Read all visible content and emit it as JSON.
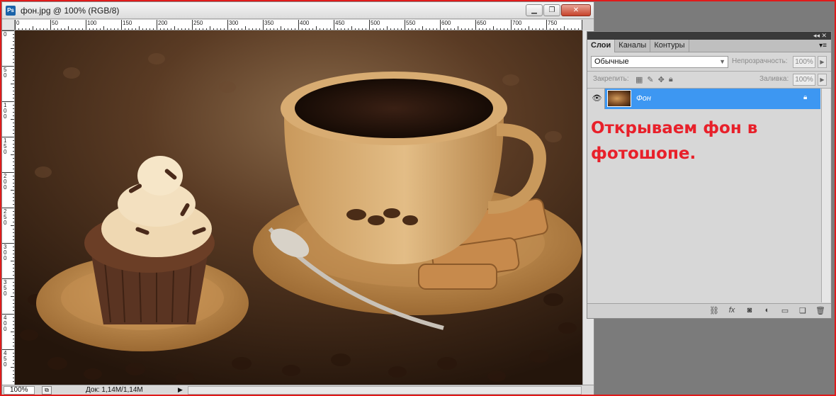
{
  "document": {
    "badge": "Ps",
    "title": "фон.jpg @ 100% (RGB/8)",
    "ruler_top_labels": [
      "0",
      "50",
      "100",
      "150",
      "200",
      "250",
      "300",
      "350",
      "400",
      "450",
      "500",
      "550",
      "600",
      "650",
      "700",
      "750"
    ],
    "ruler_left_labels": [
      "0",
      "5 0",
      "1 0 0",
      "1 5 0",
      "2 0 0",
      "2 5 0",
      "3 0 0",
      "3 5 0",
      "4 0 0",
      "4 5 0"
    ],
    "status_zoom": "100%",
    "status_doc": "Док: 1,14M/1,14M"
  },
  "panel": {
    "collapse_icon": "◂◂ ✕",
    "tabs": [
      "Слои",
      "Каналы",
      "Контуры"
    ],
    "menu_icon": "▾≡",
    "blend_mode": "Обычные",
    "opacity_label": "Непрозрачность:",
    "opacity_value": "100%",
    "lock_label": "Закрепить:",
    "fill_label": "Заливка:",
    "fill_value": "100%",
    "layers": [
      {
        "name": "Фон",
        "visible": true,
        "locked": true
      }
    ],
    "annotation_line1": "Открываем фон в",
    "annotation_line2": "фотошопе.",
    "annotation_color": "#e8202a",
    "selection_color": "#3d97f2"
  }
}
